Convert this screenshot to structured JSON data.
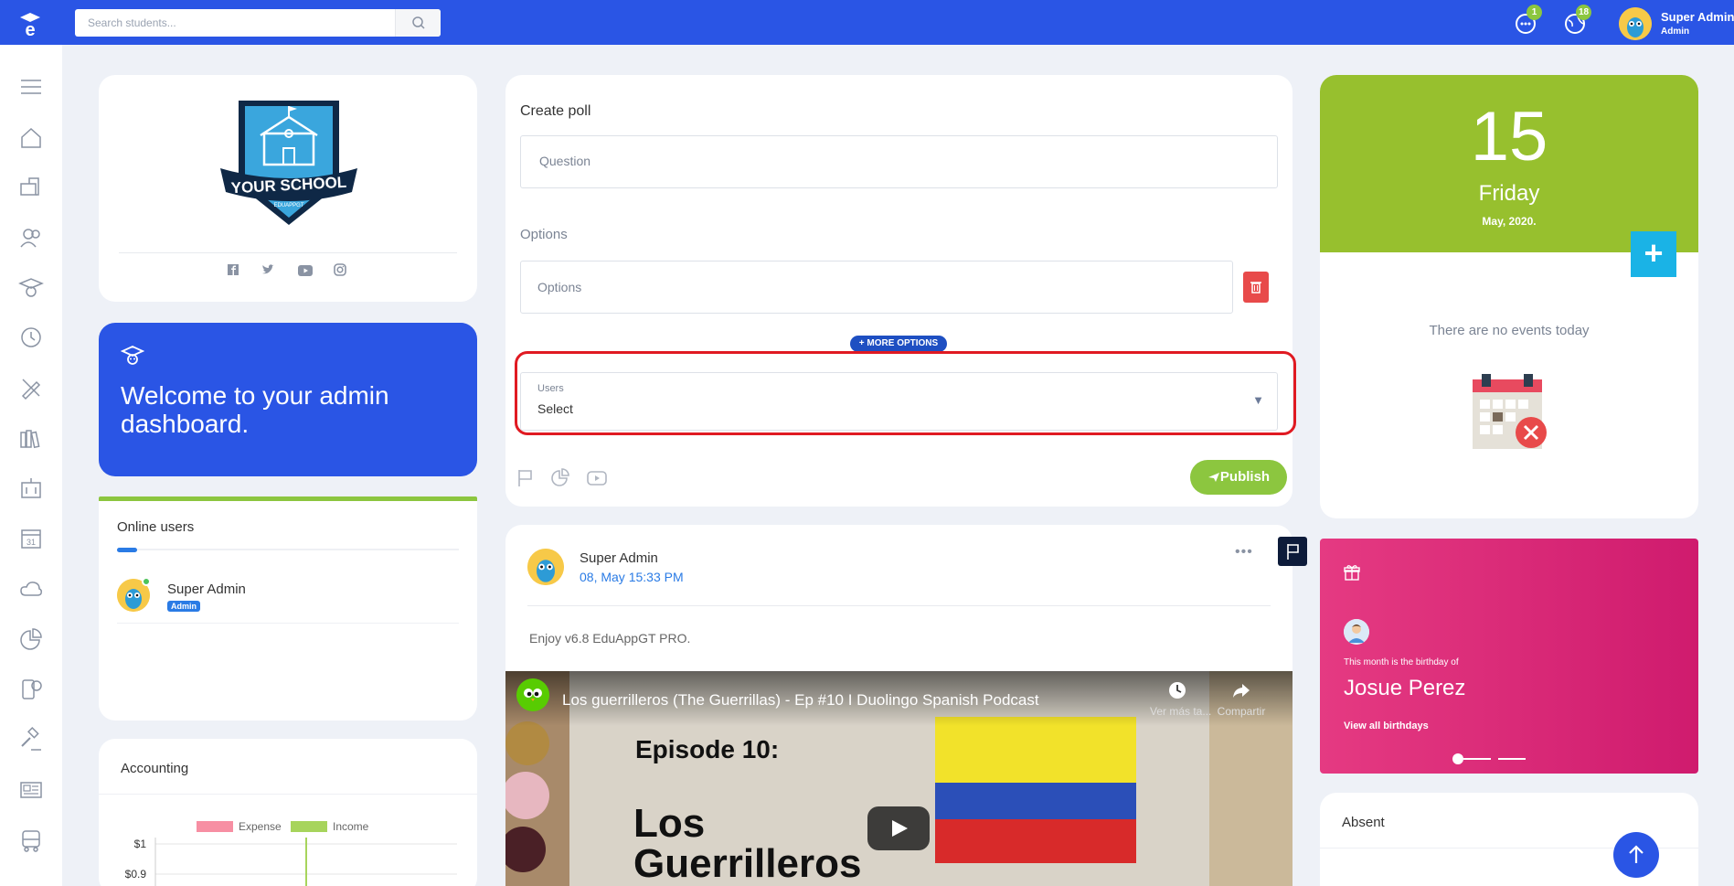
{
  "topbar": {
    "search_placeholder": "Search students...",
    "messages_count": "1",
    "notifications_count": "18",
    "user_name": "Super Admin",
    "user_role": "Admin"
  },
  "profile": {
    "school_logo_top": "YOUR SCHOOL",
    "school_logo_sub": "EDUAPPGT"
  },
  "welcome": {
    "text": "Welcome to your admin dashboard."
  },
  "online_users": {
    "title": "Online users",
    "users": [
      {
        "name": "Super Admin",
        "role": "Admin"
      }
    ]
  },
  "accounting": {
    "title": "Accounting",
    "chart_data": {
      "type": "bar",
      "title": "",
      "series": [
        {
          "name": "Expense",
          "color": "#f78fa3"
        },
        {
          "name": "Income",
          "color": "#a7d45c"
        }
      ],
      "y_tick_labels": [
        "$1",
        "$0.9"
      ]
    }
  },
  "poll": {
    "title": "Create poll",
    "question_placeholder": "Question",
    "options_label": "Options",
    "options_placeholder": "Options",
    "more_options": "+ MORE OPTIONS",
    "users_label": "Users",
    "users_value": "Select",
    "publish": "Publish"
  },
  "post": {
    "author": "Super Admin",
    "date": "08, May 15:33 PM",
    "text": "Enjoy v6.8 EduAppGT PRO.",
    "video_title": "Los guerrilleros (The Guerrillas) - Ep #10 I Duolingo Spanish Podcast",
    "video_watch_later": "Ver más ta...",
    "video_share": "Compartir",
    "episode_label": "Episode 10:",
    "episode_name_1": "Los",
    "episode_name_2": "Guerrilleros"
  },
  "calendar": {
    "day": "15",
    "weekday": "Friday",
    "month_year": "May, 2020.",
    "add": "+",
    "no_events": "There are no events today"
  },
  "birthday": {
    "caption": "This month is the birthday of",
    "name": "Josue Perez",
    "link": "View all birthdays"
  },
  "absent": {
    "title": "Absent"
  },
  "colors": {
    "primary": "#2a55e5",
    "green": "#8cc63f",
    "calendar_green": "#97c02e",
    "pink": "#d92273",
    "red": "#e84a4a"
  }
}
